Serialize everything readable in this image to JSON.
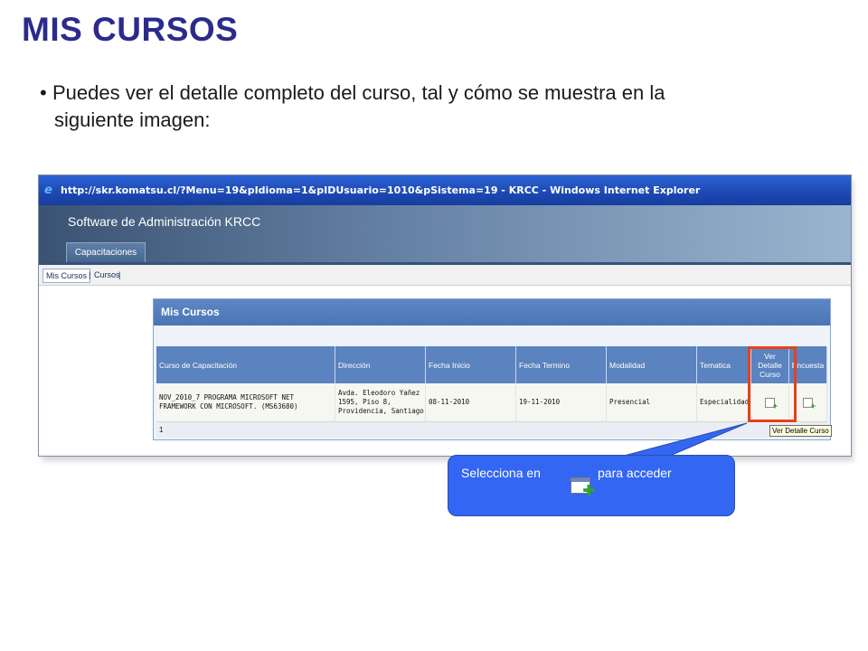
{
  "slide": {
    "title": "MIS CURSOS",
    "bullet_line1": "Puedes ver el detalle completo del curso, tal y cómo se muestra en la",
    "bullet_line2": "siguiente imagen:",
    "bullet_marker": "•"
  },
  "browser": {
    "title_bar": "http://skr.komatsu.cl/?Menu=19&pIdioma=1&pIDUsuario=1010&pSistema=19 - KRCC - Windows Internet Explorer",
    "app_title": "Software de Administración KRCC",
    "tab_label": "Capacitaciones",
    "nav": {
      "mis_cursos": "Mis Cursos",
      "sep1": "|",
      "cursos": "Cursos",
      "sep2": "|"
    }
  },
  "panel": {
    "title": "Mis Cursos",
    "columns": [
      "Curso de Capacitación",
      "Dirección",
      "Fecha Inicio",
      "Fecha Termino",
      "Modalidad",
      "Tematica",
      "Ver Detalle Curso",
      "Encuesta"
    ],
    "rows": [
      {
        "curso": "NOV_2010_7 PROGRAMA MICROSOFT NET FRAMEWORK CON MICROSOFT. (MS63680)",
        "direccion": "Avda. Eleodoro Yañez 1595, Piso 8, Providencia, Santiago",
        "fecha_inicio": "08-11-2010",
        "fecha_termino": "19-11-2010",
        "modalidad": "Presencial",
        "tematica": "Especialidad"
      }
    ],
    "pager": "1",
    "tooltip": "Ver Detalle Curso"
  },
  "callout": {
    "text_before": "Selecciona en",
    "text_after": "para acceder",
    "bg_color": "#3366f2"
  },
  "colors": {
    "title": "#2b2b8c",
    "highlight": "#e8401c",
    "grid_header": "#5a83bf"
  }
}
